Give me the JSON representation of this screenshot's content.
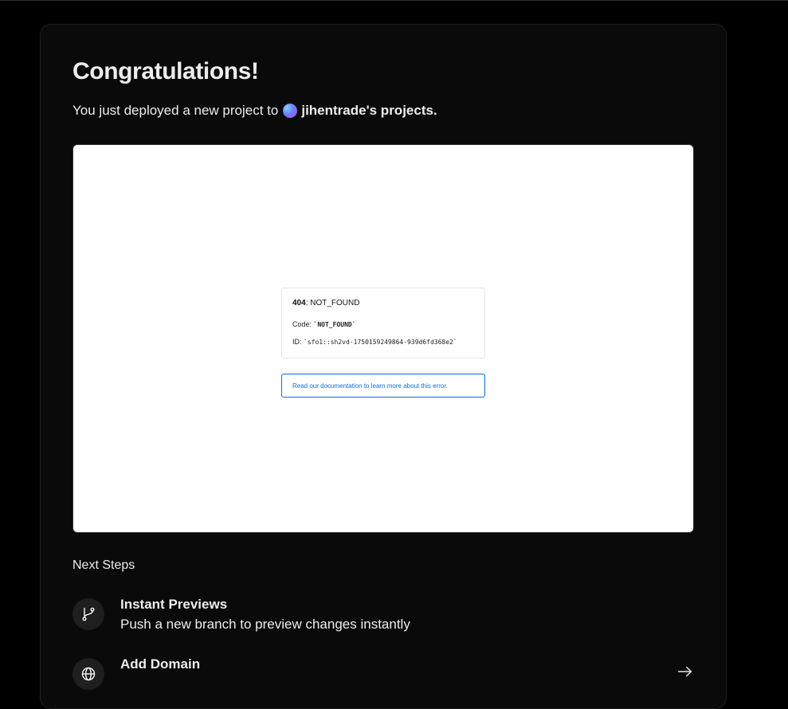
{
  "header": {
    "title": "Congratulations!",
    "subtitle_prefix": "You just deployed a new project to",
    "team_name": "jihentrade's projects."
  },
  "preview": {
    "error_code": "404",
    "error_suffix": ": NOT_FOUND",
    "code_label": "Code: ",
    "code_value": "`NOT_FOUND`",
    "id_label": "ID: ",
    "id_value": "`sfo1::sh2vd-1750159249864-939d6fd368e2`",
    "doc_link": "Read our documentation to learn more about this error."
  },
  "next_steps": {
    "label": "Next Steps",
    "items": [
      {
        "title": "Instant Previews",
        "desc": "Push a new branch to preview changes instantly",
        "icon": "git-branch-icon"
      },
      {
        "title": "Add Domain",
        "desc": "",
        "icon": "globe-icon"
      }
    ]
  },
  "colors": {
    "background": "#000000",
    "card": "#0a0a0a",
    "link": "#0070f3"
  }
}
